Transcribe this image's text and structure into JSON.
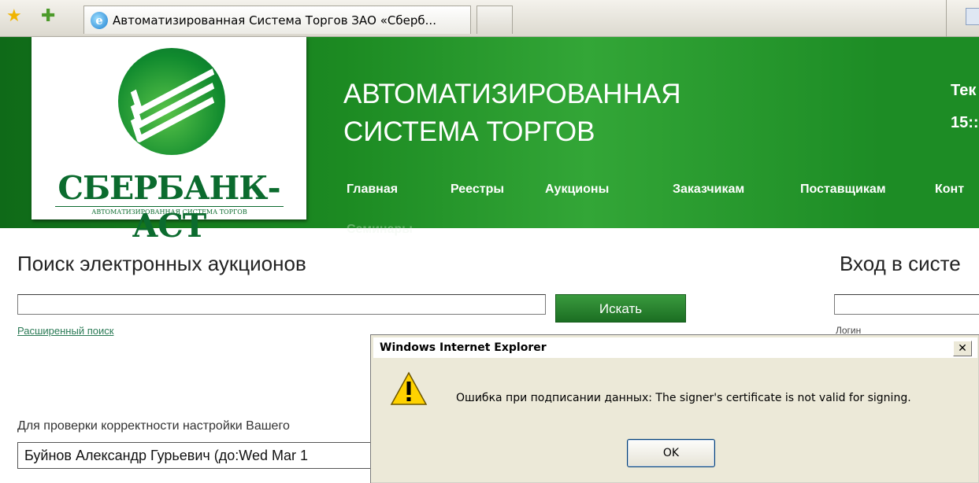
{
  "browser": {
    "tab_title": "Автоматизированная Система Торгов ЗАО «Сбербанк-АСТ»",
    "tab_title_display": "Автоматизированная Система Торгов ЗАО «Сберб...",
    "icons": [
      "favorites-star-icon",
      "add-favorites-icon",
      "ie-logo-icon",
      "home-icon"
    ]
  },
  "header": {
    "logo_name": "СБЕРБАНК-АСТ",
    "logo_subtitle": "АВТОМАТИЗИРОВАННАЯ СИСТЕМА ТОРГОВ",
    "title_line1": "АВТОМАТИЗИРОВАННАЯ",
    "title_line2": "СИСТЕМА ТОРГОВ",
    "time_label": "Тек",
    "time_value": "15::",
    "nav": [
      "Главная",
      "Реестры",
      "Аукционы",
      "Заказчикам",
      "Поставщикам",
      "Конт",
      "Семинары"
    ],
    "colors": {
      "green_dark": "#0f6a18",
      "green_light": "#33a637"
    }
  },
  "search": {
    "title": "Поиск электронных аукционов",
    "input_value": "",
    "button_label": "Искать",
    "advanced_link": "Расширенный поиск"
  },
  "login": {
    "title": "Вход в систе",
    "input_value": "",
    "label": "Логин"
  },
  "certificate": {
    "check_text": "Для проверки корректности настройки Вашего",
    "selected": "Буйнов Александр Гурьевич (до:Wed Mar 1"
  },
  "dialog": {
    "title": "Windows Internet Explorer",
    "close_label": "✕",
    "message": "Ошибка при подписании данных: The signer's certificate is not valid for signing.",
    "ok_label": "OK",
    "icon": "warning-icon"
  }
}
